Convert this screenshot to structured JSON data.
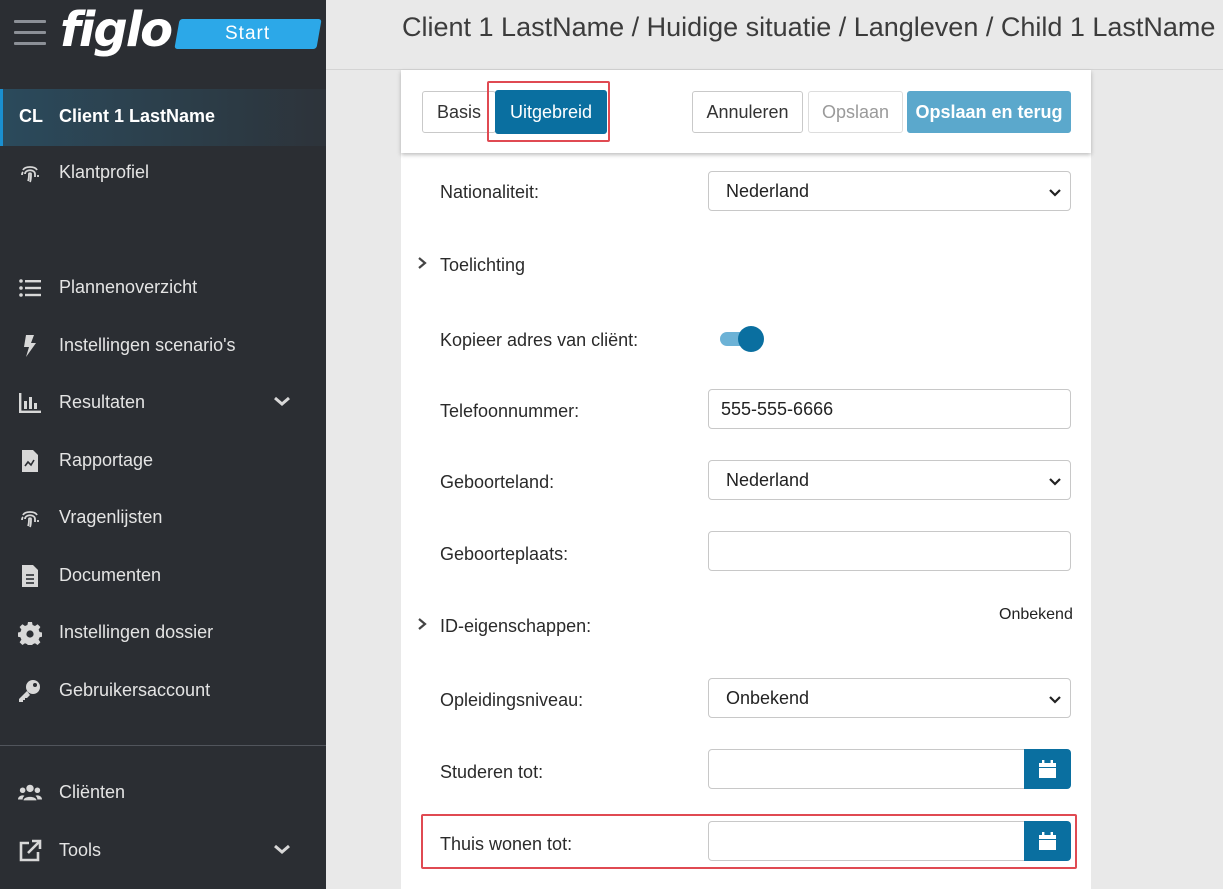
{
  "brand": {
    "logo": "figlo",
    "badge": "Start"
  },
  "sidebar": {
    "client": {
      "abbr": "CL",
      "name": "Client 1 LastName"
    },
    "items": [
      {
        "label": "Klantprofiel",
        "icon": "fingerprint-icon"
      },
      {
        "label": "Plannenoverzicht",
        "icon": "list-icon"
      },
      {
        "label": "Instellingen scenario's",
        "icon": "bolt-icon"
      },
      {
        "label": "Resultaten",
        "icon": "bar-chart-icon"
      },
      {
        "label": "Rapportage",
        "icon": "report-file-icon"
      },
      {
        "label": "Vragenlijsten",
        "icon": "fingerprint-icon"
      },
      {
        "label": "Documenten",
        "icon": "document-icon"
      },
      {
        "label": "Instellingen dossier",
        "icon": "gear-icon"
      },
      {
        "label": "Gebruikersaccount",
        "icon": "key-icon"
      }
    ],
    "bottom_items": [
      {
        "label": "Cliënten",
        "icon": "users-icon"
      },
      {
        "label": "Tools",
        "icon": "external-link-icon"
      }
    ]
  },
  "header": {
    "breadcrumb": "Client 1 LastName / Huidige situatie / Langleven / Child 1 LastName"
  },
  "toolbar": {
    "basis": "Basis",
    "uitgebreid": "Uitgebreid",
    "annuleren": "Annuleren",
    "opslaan": "Opslaan",
    "opslaan_terug": "Opslaan en terug"
  },
  "form": {
    "nationaliteit": {
      "label": "Nationaliteit:",
      "value": "Nederland"
    },
    "toelichting": {
      "label": "Toelichting"
    },
    "kopieer_adres": {
      "label": "Kopieer adres van cliënt:",
      "checked": true
    },
    "telefoon": {
      "label": "Telefoonnummer:",
      "value": "555-555-6666"
    },
    "geboorteland": {
      "label": "Geboorteland:",
      "value": "Nederland"
    },
    "geboorteplaats": {
      "label": "Geboorteplaats:",
      "value": ""
    },
    "id_eigenschappen": {
      "label": "ID-eigenschappen:",
      "status": "Onbekend"
    },
    "opleidingsniveau": {
      "label": "Opleidingsniveau:",
      "value": "Onbekend"
    },
    "studeren_tot": {
      "label": "Studeren tot:",
      "value": ""
    },
    "thuis_wonen_tot": {
      "label": "Thuis wonen tot:",
      "value": ""
    }
  },
  "colors": {
    "sidebar_bg": "#2b2e33",
    "primary": "#0a6fa0",
    "badge": "#2ca8e8",
    "highlight": "#e04a52"
  }
}
